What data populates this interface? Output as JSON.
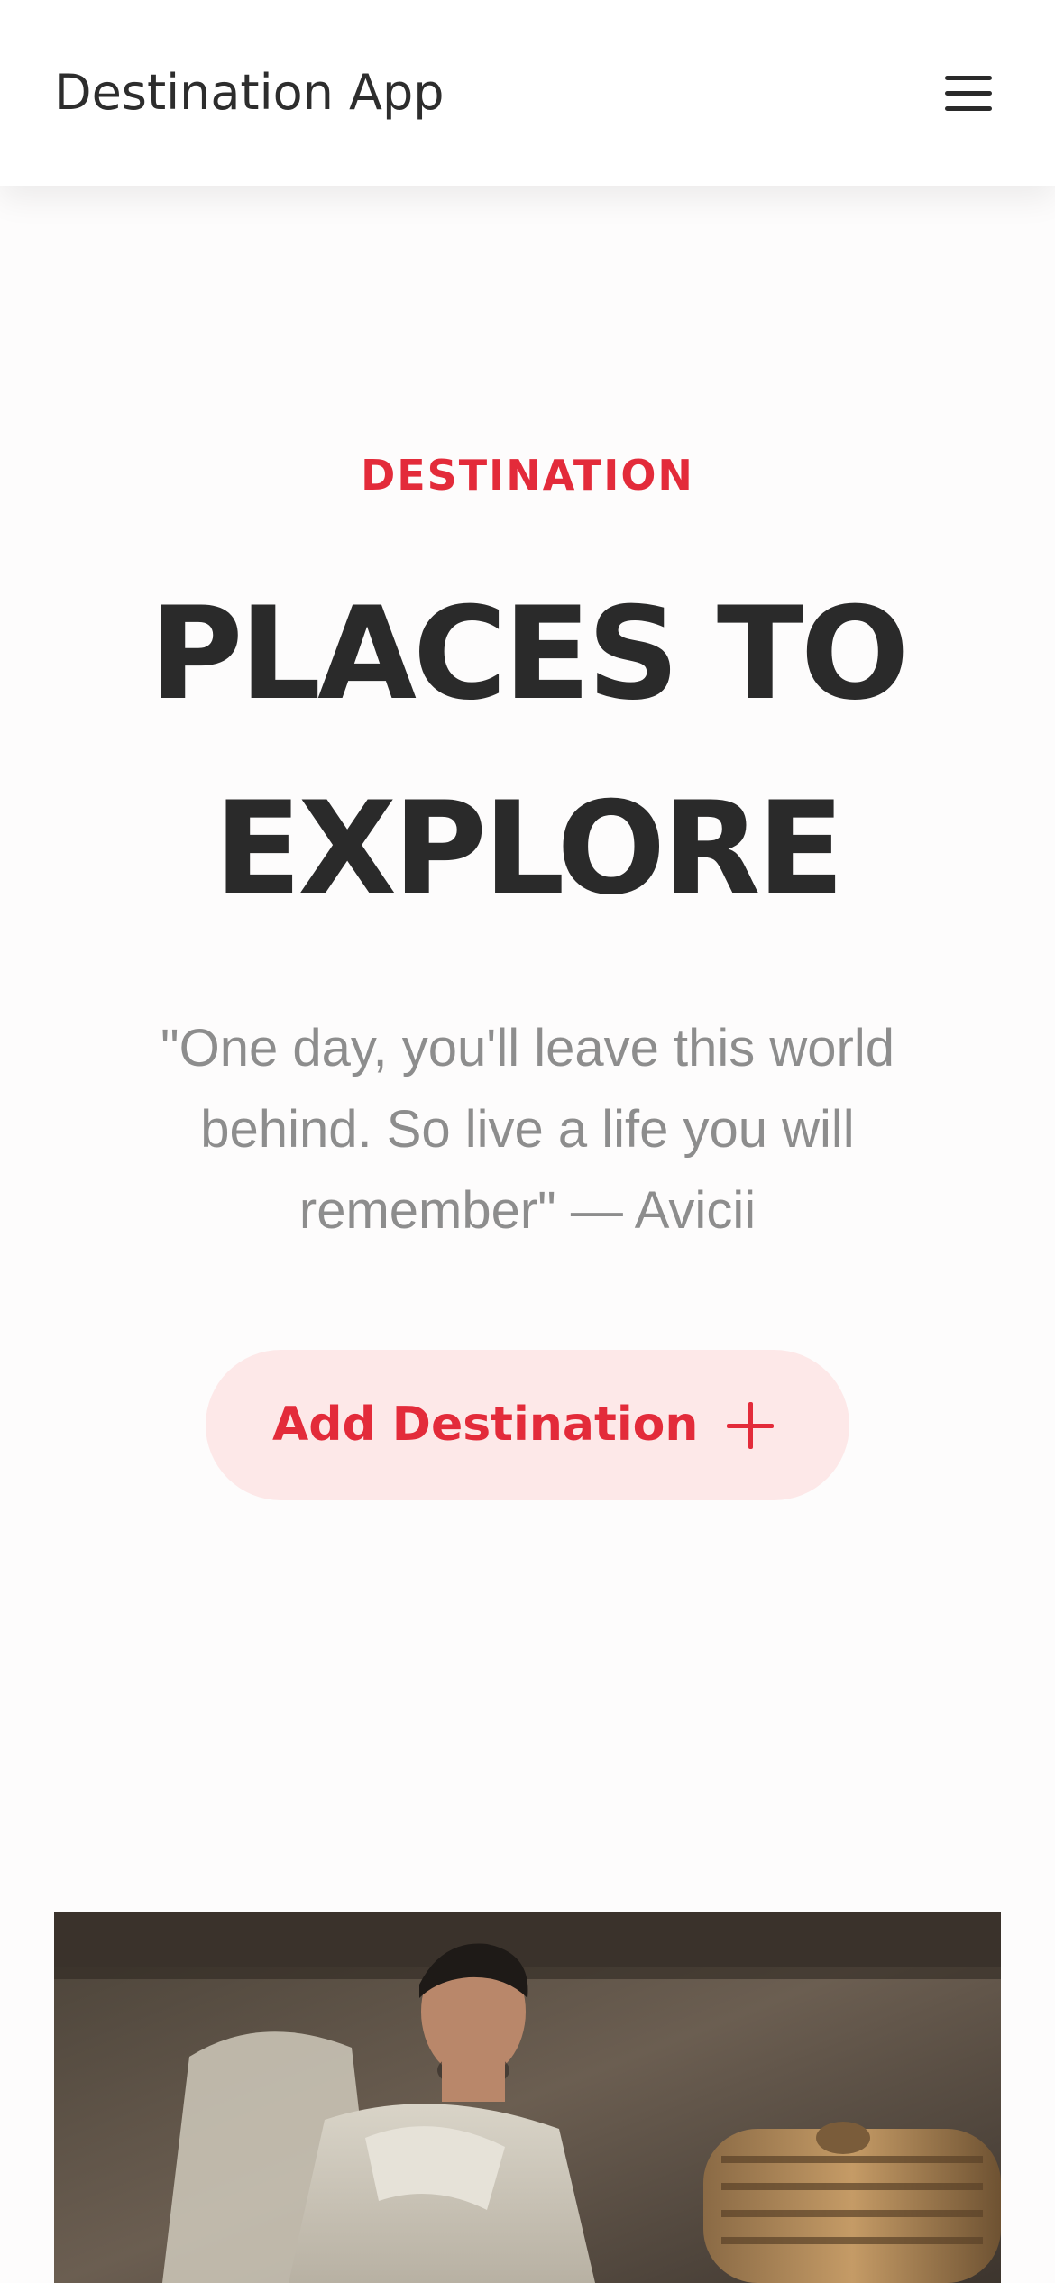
{
  "header": {
    "brand": "Destination App",
    "menu_icon": "hamburger-menu-icon"
  },
  "hero": {
    "eyebrow": "DESTINATION",
    "title_line1": "PLACES TO",
    "title_line2": "EXPLORE",
    "quote": "\"One day, you'll leave this world behind. So live a life you will remember\" — Avicii",
    "button_label": "Add Destination",
    "button_icon": "plus-icon"
  },
  "colors": {
    "accent": "#e32b3a",
    "button_bg": "#fde8e8",
    "heading": "#2a2a2a",
    "quote": "#8d8d8d"
  },
  "card": {
    "image_icon": "destination-photo"
  }
}
